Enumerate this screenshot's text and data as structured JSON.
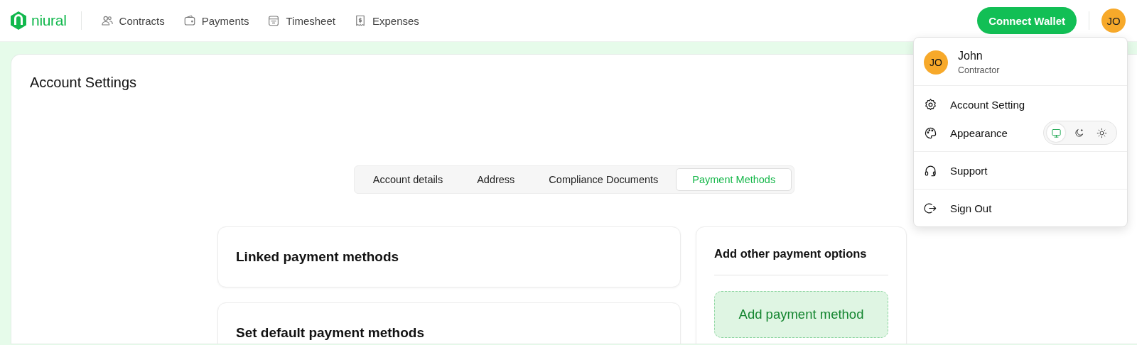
{
  "header": {
    "logo": "niural",
    "nav": [
      {
        "label": "Contracts",
        "kind": "people"
      },
      {
        "label": "Payments",
        "kind": "wallet"
      },
      {
        "label": "Timesheet",
        "kind": "calendar"
      },
      {
        "label": "Expenses",
        "kind": "receipt"
      }
    ],
    "connect_button": "Connect Wallet",
    "avatar": "JO"
  },
  "page": {
    "title": "Account Settings",
    "tabs": [
      {
        "label": "Account details",
        "selected": false
      },
      {
        "label": "Address",
        "selected": false
      },
      {
        "label": "Compliance Documents",
        "selected": false
      },
      {
        "label": "Payment Methods",
        "selected": true
      }
    ],
    "left_cards": [
      {
        "title": "Linked payment methods"
      },
      {
        "title": "Set default payment methods"
      }
    ],
    "right_card": {
      "title": "Add other payment options",
      "button": "Add payment method"
    }
  },
  "user_menu": {
    "avatar": "JO",
    "name": "John",
    "role": "Contractor",
    "items": [
      {
        "kind": "settings",
        "label": "Account Setting"
      },
      {
        "kind": "appearance",
        "label": "Appearance",
        "modes": [
          {
            "kind": "system",
            "selected": true
          },
          {
            "kind": "dark",
            "selected": false
          },
          {
            "kind": "light",
            "selected": false
          }
        ]
      },
      {
        "kind": "support",
        "label": "Support"
      },
      {
        "kind": "signout",
        "label": "Sign Out"
      }
    ]
  }
}
